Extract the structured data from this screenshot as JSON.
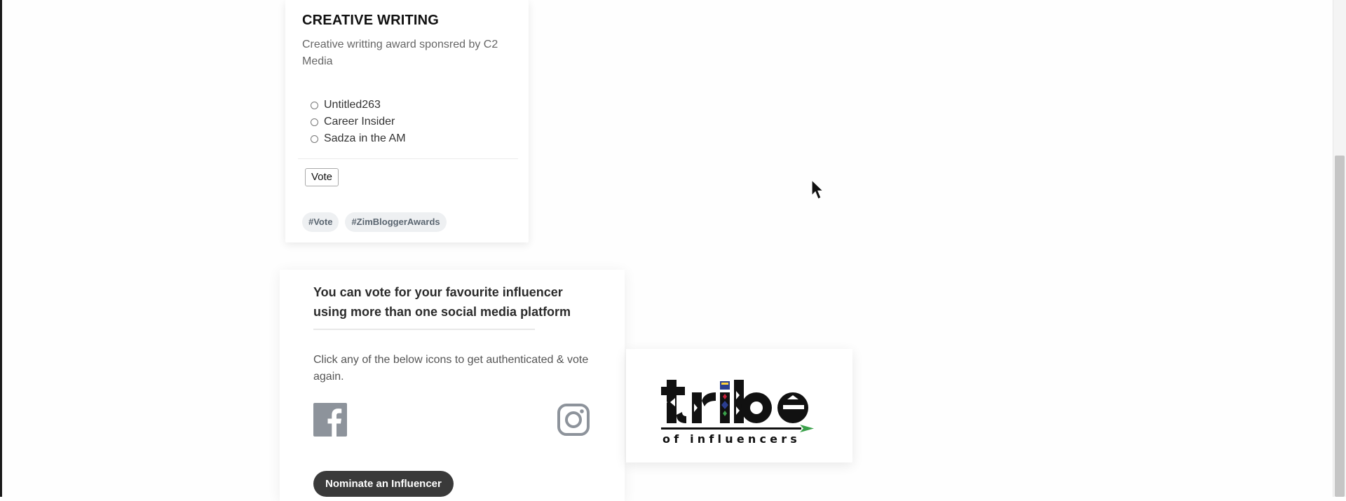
{
  "poll": {
    "title": "CREATIVE WRITING",
    "description": "Creative writting award sponsred by C2 Media",
    "options": [
      {
        "label": "Untitled263",
        "selected": false
      },
      {
        "label": "Career Insider",
        "selected": false
      },
      {
        "label": "Sadza in the AM",
        "selected": false
      }
    ],
    "vote_label": "Vote",
    "tags": [
      "#Vote",
      "#ZimBloggerAwards"
    ]
  },
  "info": {
    "heading": "You can vote for your favourite influencer using more than one social media platform",
    "text": "Click any of the below icons to get authenticated & vote again.",
    "icons": [
      "facebook-icon",
      "instagram-icon"
    ],
    "nominate_label": "Nominate an Influencer"
  },
  "logo": {
    "name": "tribe of influencers"
  },
  "colors": {
    "button_dark": "#3a3a3a",
    "icon_gray": "#8d939b",
    "tag_bg": "#eef0f2",
    "logo_green": "#3aa04a",
    "logo_red": "#c8203a",
    "logo_blue": "#2b3e8f"
  }
}
